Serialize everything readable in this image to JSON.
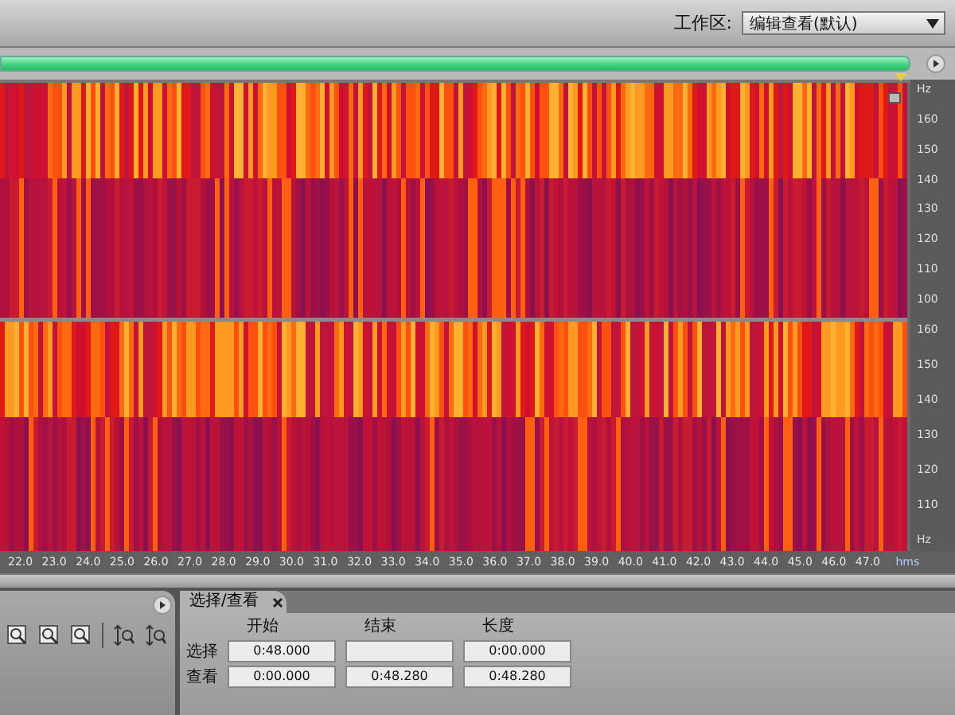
{
  "workspace": {
    "label": "工作区:",
    "value": "编辑查看(默认)"
  },
  "frequency_axis": {
    "channels": [
      {
        "labels": [
          "Hz",
          "160",
          "150",
          "140",
          "130",
          "120",
          "110",
          "100"
        ]
      },
      {
        "labels": [
          "160",
          "150",
          "140",
          "130",
          "120",
          "110",
          "Hz"
        ]
      }
    ]
  },
  "time_ruler": {
    "ticks": [
      "22.0",
      "23.0",
      "24.0",
      "25.0",
      "26.0",
      "27.0",
      "28.0",
      "29.0",
      "30.0",
      "31.0",
      "32.0",
      "33.0",
      "34.0",
      "35.0",
      "36.0",
      "37.0",
      "38.0",
      "39.0",
      "40.0",
      "41.0",
      "42.0",
      "43.0",
      "44.0",
      "45.0",
      "46.0",
      "47.0"
    ],
    "unit": "hms"
  },
  "selection_panel": {
    "tabs": [
      {
        "label": "选择/查看",
        "selected": true
      }
    ],
    "columns": [
      "开始",
      "结束",
      "长度"
    ],
    "rows": [
      {
        "label": "选择",
        "cells": [
          {
            "value": "0:48.000"
          },
          {},
          {
            "value": "0:00.000"
          }
        ]
      },
      {
        "label": "查看",
        "cells": [
          {
            "value": "0:00.000"
          },
          {
            "value": "0:48.280"
          },
          {
            "value": "0:48.280"
          }
        ]
      }
    ]
  }
}
